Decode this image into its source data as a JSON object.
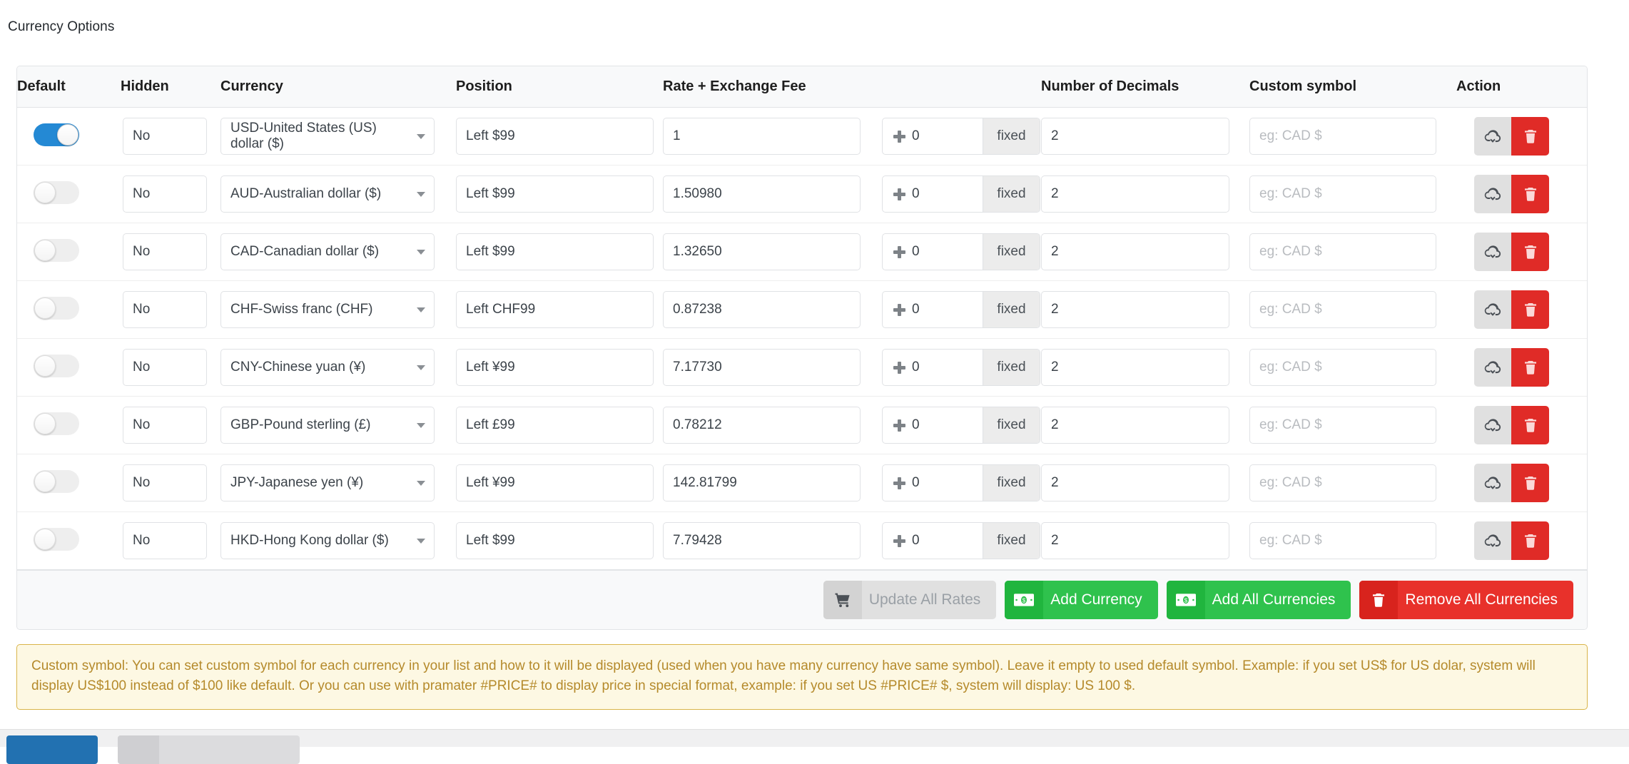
{
  "page": {
    "title": "Currency Options"
  },
  "table": {
    "headers": {
      "default": "Default",
      "hidden": "Hidden",
      "currency": "Currency",
      "position": "Position",
      "rate_fee": "Rate + Exchange Fee",
      "decimals": "Number of Decimals",
      "custom_symbol": "Custom symbol",
      "action": "Action"
    },
    "placeholders": {
      "custom_symbol": "eg: CAD $"
    },
    "icons": {
      "toggle": "toggle-switch",
      "select_caret": "chevron-down-icon",
      "fee_plus": "plus-icon",
      "download": "cloud-download-icon",
      "delete": "trash-icon"
    },
    "rows": [
      {
        "default_on": true,
        "hidden": "No",
        "currency": "USD-United States (US) dollar ($)",
        "position": "Left $99",
        "rate": "1",
        "fee": "0",
        "fee_unit": "fixed",
        "decimals": "2",
        "custom_symbol": ""
      },
      {
        "default_on": false,
        "hidden": "No",
        "currency": "AUD-Australian dollar ($)",
        "position": "Left $99",
        "rate": "1.50980",
        "fee": "0",
        "fee_unit": "fixed",
        "decimals": "2",
        "custom_symbol": ""
      },
      {
        "default_on": false,
        "hidden": "No",
        "currency": "CAD-Canadian dollar ($)",
        "position": "Left $99",
        "rate": "1.32650",
        "fee": "0",
        "fee_unit": "fixed",
        "decimals": "2",
        "custom_symbol": ""
      },
      {
        "default_on": false,
        "hidden": "No",
        "currency": "CHF-Swiss franc (CHF)",
        "position": "Left CHF99",
        "rate": "0.87238",
        "fee": "0",
        "fee_unit": "fixed",
        "decimals": "2",
        "custom_symbol": ""
      },
      {
        "default_on": false,
        "hidden": "No",
        "currency": "CNY-Chinese yuan (¥)",
        "position": "Left ¥99",
        "rate": "7.17730",
        "fee": "0",
        "fee_unit": "fixed",
        "decimals": "2",
        "custom_symbol": ""
      },
      {
        "default_on": false,
        "hidden": "No",
        "currency": "GBP-Pound sterling (£)",
        "position": "Left £99",
        "rate": "0.78212",
        "fee": "0",
        "fee_unit": "fixed",
        "decimals": "2",
        "custom_symbol": ""
      },
      {
        "default_on": false,
        "hidden": "No",
        "currency": "JPY-Japanese yen (¥)",
        "position": "Left ¥99",
        "rate": "142.81799",
        "fee": "0",
        "fee_unit": "fixed",
        "decimals": "2",
        "custom_symbol": ""
      },
      {
        "default_on": false,
        "hidden": "No",
        "currency": "HKD-Hong Kong dollar ($)",
        "position": "Left $99",
        "rate": "7.79428",
        "fee": "0",
        "fee_unit": "fixed",
        "decimals": "2",
        "custom_symbol": ""
      }
    ]
  },
  "footer_actions": [
    {
      "label": "Update All Rates",
      "icon": "cart-download-icon",
      "style": "btn-grey",
      "disabled": true
    },
    {
      "label": "Add Currency",
      "icon": "banknote-icon",
      "style": "btn-green",
      "disabled": false
    },
    {
      "label": "Add All Currencies",
      "icon": "banknote-icon",
      "style": "btn-green",
      "disabled": false
    },
    {
      "label": "Remove All Currencies",
      "icon": "trash-icon",
      "style": "btn-red",
      "disabled": false
    }
  ],
  "notice": {
    "text": "Custom symbol: You can set custom symbol for each currency in your list and how to it will be displayed (used when you have many currency have same symbol). Leave it empty to used default symbol. Example: if you set US$ for US dolar, system will display US$100 instead of $100 like default. Or you can use with pramater #PRICE# to display price in special format, example: if you set US #PRICE# $, system will display: US 100 $."
  },
  "colors": {
    "toggle_on": "#2489d4",
    "green": "#2fc24d",
    "red": "#e8312b",
    "notice_bg": "#fdf8e3",
    "notice_border": "#d9b44a",
    "notice_text": "#b58a2b",
    "primary_blue": "#2271b1"
  }
}
